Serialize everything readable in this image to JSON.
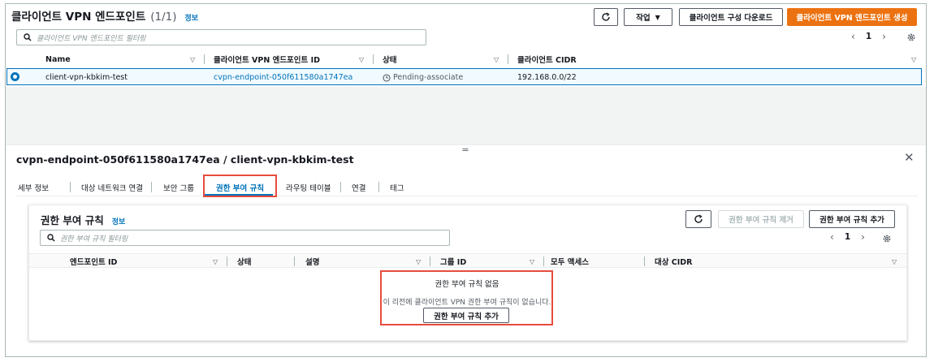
{
  "top": {
    "title": "클라이언트 VPN 엔드포인트",
    "count": "(1/1)",
    "info": "정보",
    "refresh_icon": "refresh-icon",
    "actions_label": "작업",
    "download_label": "클라이언트 구성 다운로드",
    "create_label": "클라이언트 VPN 엔드포인트 생성",
    "search_placeholder": "클라이언트 VPN 엔드포인트 필터링",
    "page": "1",
    "columns": [
      "Name",
      "클라이언트 VPN 엔드포인트 ID",
      "상태",
      "클라이언트 CIDR"
    ],
    "row": {
      "name": "client-vpn-kbkim-test",
      "endpoint_id": "cvpn-endpoint-050f611580a1747ea",
      "status": "Pending-associate",
      "cidr": "192.168.0.0/22"
    }
  },
  "detail": {
    "title": "cvpn-endpoint-050f611580a1747ea / client-vpn-kbkim-test",
    "tabs": [
      "세부 정보",
      "대상 네트워크 연결",
      "보안 그룹",
      "권한 부여 규칙",
      "라우팅 테이블",
      "연결",
      "태그"
    ],
    "active_tab": "권한 부여 규칙"
  },
  "auth": {
    "title": "권한 부여 규칙",
    "info": "정보",
    "remove_label": "권한 부여 규칙 제거",
    "add_label": "권한 부여 규칙 추가",
    "search_placeholder": "권한 부여 규칙 필터링",
    "page": "1",
    "columns": [
      "엔드포인트 ID",
      "상태",
      "설명",
      "그룹 ID",
      "모두 액세스",
      "대상 CIDR"
    ],
    "empty_title": "권한 부여 규칙 없음",
    "empty_desc": "이 리전에 클라이언트 VPN 권한 부여 규칙이 없습니다.",
    "empty_button": "권한 부여 규칙 추가"
  },
  "colors": {
    "accent": "#0073bb",
    "primary": "#ec7211",
    "highlight": "#e74c3c"
  }
}
